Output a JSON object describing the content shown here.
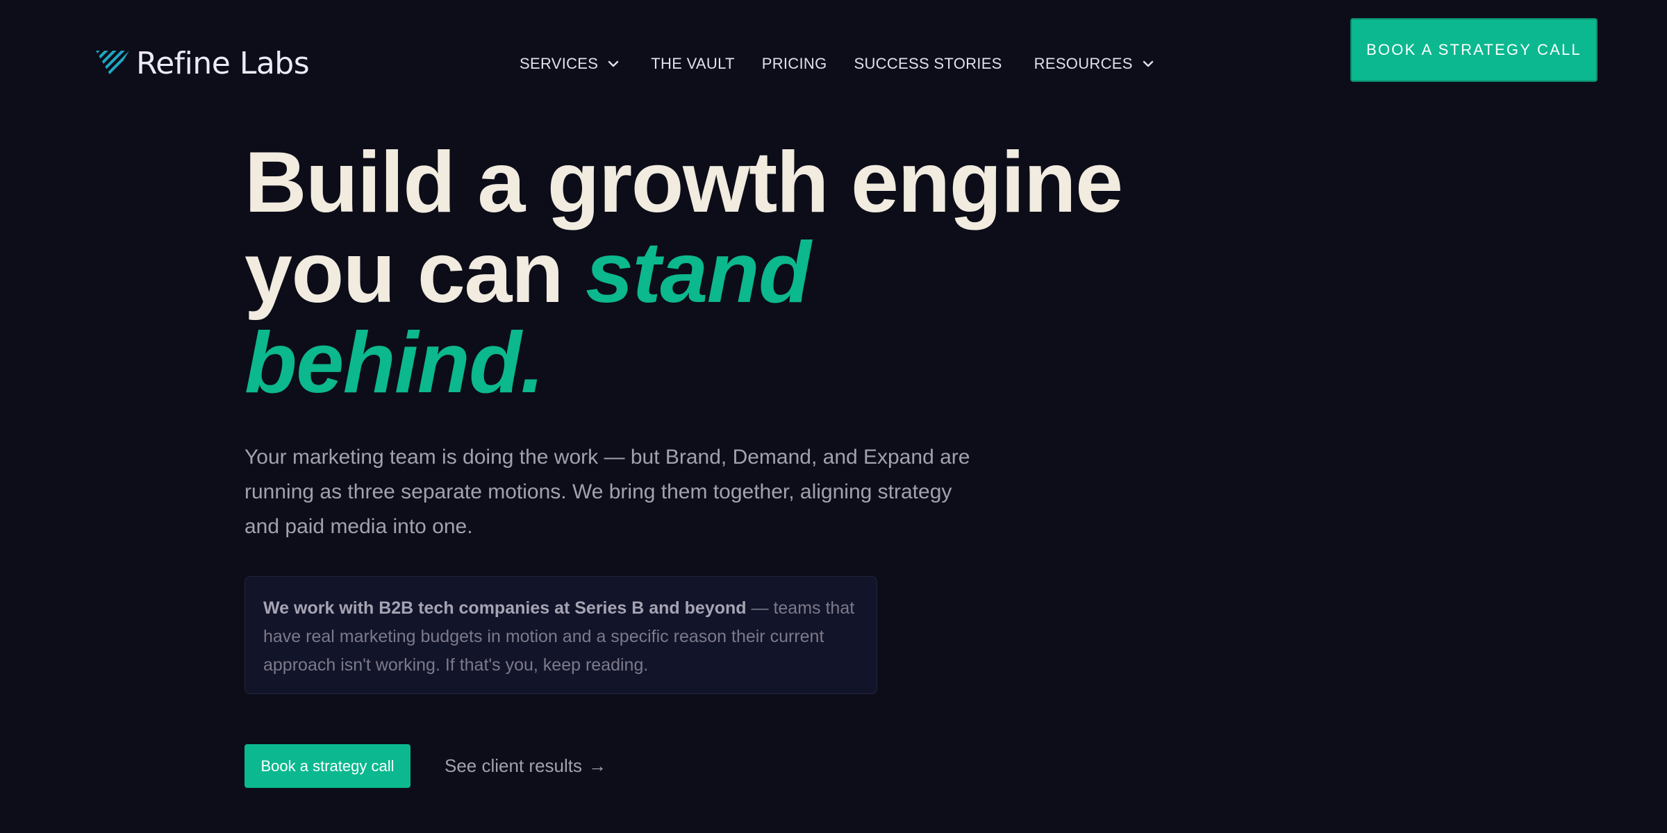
{
  "brand": {
    "name": "Refine Labs",
    "logo_icon": "striped-diamond-logo-icon",
    "colors": {
      "background": "#0c0d18",
      "accent": "#0bb88f",
      "headline": "#f1ebe0",
      "body_text": "#a3a1ad"
    }
  },
  "nav": {
    "items": [
      {
        "label": "SERVICES",
        "has_dropdown": true
      },
      {
        "label": "THE VAULT",
        "has_dropdown": false
      },
      {
        "label": "PRICING",
        "has_dropdown": false
      },
      {
        "label": "SUCCESS STORIES",
        "has_dropdown": false
      },
      {
        "label": "RESOURCES",
        "has_dropdown": true
      }
    ],
    "dropdown_icon": "chevron-down-icon",
    "cta_label": "BOOK A STRATEGY CALL"
  },
  "hero": {
    "title_line1": "Build a growth engine",
    "title_line2_plain": "you can",
    "title_line2_accent": "stand",
    "title_line3_accent": "behind.",
    "subtext": "Your marketing team is doing the work — but Brand, Demand, and Expand are running as three separate motions. We bring them together, aligning strategy and paid media into one.",
    "callout_strong": "We work with B2B tech companies at Series B and beyond",
    "callout_rest": " — teams that have real marketing budgets in motion and a specific reason their current approach isn't working. If that's you, keep reading.",
    "cta_primary": "Book a strategy call",
    "cta_secondary": "See client results",
    "cta_secondary_arrow": "→"
  }
}
